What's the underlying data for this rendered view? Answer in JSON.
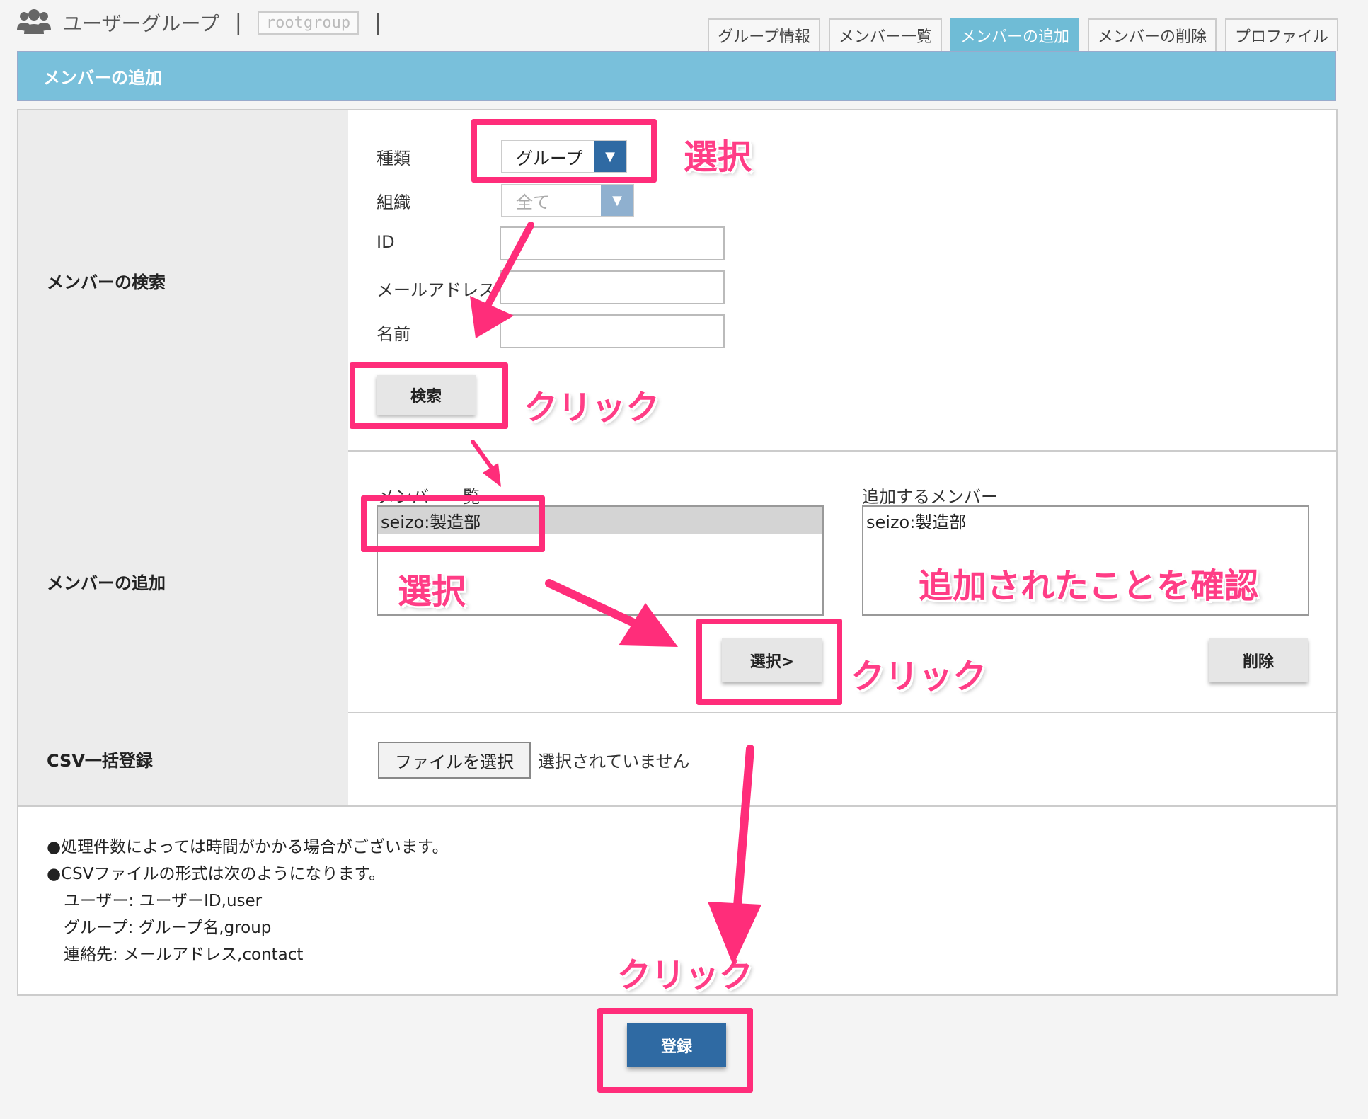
{
  "header": {
    "title": "ユーザーグループ",
    "separator": "|",
    "group_name": "rootgroup"
  },
  "tabs": [
    {
      "label": "グループ情報",
      "active": false
    },
    {
      "label": "メンバー一覧",
      "active": false
    },
    {
      "label": "メンバーの追加",
      "active": true
    },
    {
      "label": "メンバーの削除",
      "active": false
    },
    {
      "label": "プロファイル",
      "active": false
    }
  ],
  "page_title": "メンバーの追加",
  "search": {
    "section_label": "メンバーの検索",
    "type_label": "種類",
    "type_value": "グループ",
    "org_label": "組織",
    "org_value": "全て",
    "id_label": "ID",
    "email_label": "メールアドレス",
    "name_label": "名前",
    "search_button": "検索"
  },
  "add": {
    "section_label": "メンバーの追加",
    "member_list_label": "メンバー一覧",
    "member_list_items": [
      "seizo:製造部"
    ],
    "to_add_label": "追加するメンバー",
    "to_add_items": [
      "seizo:製造部"
    ],
    "select_button": "選択>",
    "delete_button": "削除"
  },
  "csv": {
    "section_label": "CSV一括登録",
    "file_button": "ファイルを選択",
    "file_status": "選択されていません"
  },
  "notes": [
    "●処理件数によっては時間がかかる場合がございます。",
    "●CSVファイルの形式は次のようになります。",
    "ユーザー: ユーザーID,user",
    "グループ: グループ名,group",
    "連絡先: メールアドレス,contact"
  ],
  "submit_button": "登録",
  "annotations": {
    "select_1": "選択",
    "click_1": "クリック",
    "select_2": "選択",
    "confirm": "追加されたことを確認",
    "click_2": "クリック",
    "click_3": "クリック"
  },
  "colors": {
    "accent": "#79c0db",
    "primary": "#2f6aa3",
    "annotation": "#ff2d7a"
  }
}
